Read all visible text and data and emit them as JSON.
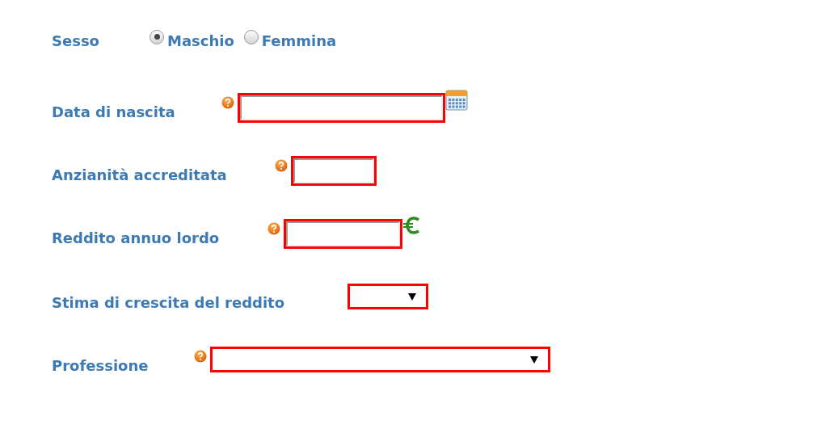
{
  "gender": {
    "label": "Sesso",
    "options": [
      {
        "label": "Maschio",
        "selected": true
      },
      {
        "label": "Femmina",
        "selected": false
      }
    ]
  },
  "fields": [
    {
      "kind": "date",
      "label": "Data di nascita",
      "help": true
    },
    {
      "kind": "text",
      "label": "Anzianità accreditata",
      "help": true
    },
    {
      "kind": "currency",
      "label": "Reddito annuo lordo",
      "help": true
    },
    {
      "kind": "select",
      "label": "Stima di crescita del reddito",
      "help": false
    },
    {
      "kind": "select",
      "label": "Professione",
      "help": true
    }
  ]
}
